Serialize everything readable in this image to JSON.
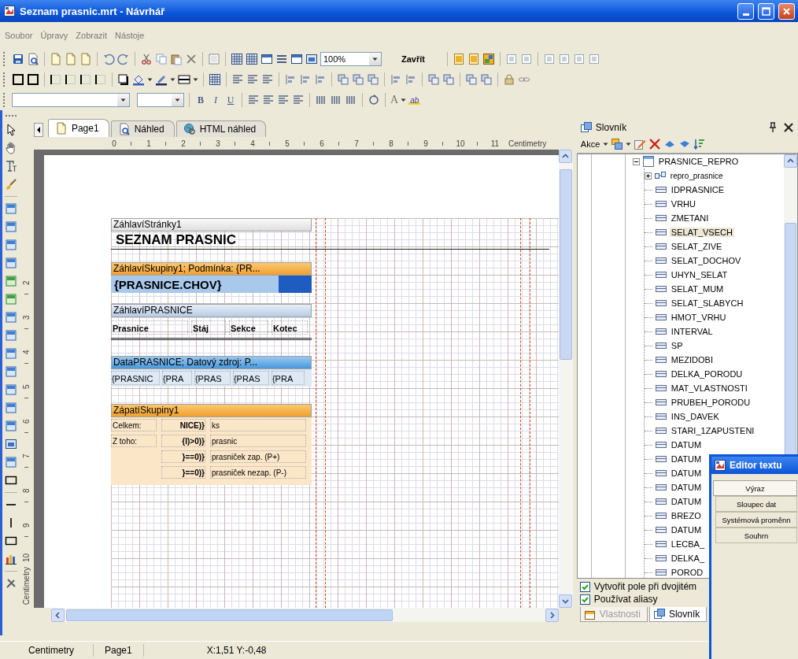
{
  "window": {
    "title": "Seznam prasnic.mrt - Návrhář"
  },
  "menu": [
    "Soubor",
    "Úpravy",
    "Zobrazit",
    "Nástoje"
  ],
  "toolbar": {
    "zoom": "100%",
    "close_button": "Zavřít"
  },
  "format_toolbar": {
    "styles": [
      "B",
      "I",
      "U"
    ],
    "font_color": "A",
    "highlight": "ab"
  },
  "tabs": [
    {
      "label": "Page1",
      "kind": "page",
      "selected": true
    },
    {
      "label": "Náhled",
      "kind": "preview",
      "selected": false
    },
    {
      "label": "HTML náhled",
      "kind": "html",
      "selected": false
    }
  ],
  "ruler": {
    "marks": [
      "0",
      "1",
      "2",
      "3",
      "4",
      "5",
      "6",
      "7",
      "8",
      "9",
      "10",
      "11"
    ],
    "unit": "Centimetry"
  },
  "vertical_ruler": {
    "marks": [
      "2",
      "3",
      "4",
      "5",
      "6",
      "7",
      "8",
      "9",
      "10"
    ],
    "unit": "Centimetry"
  },
  "bands": [
    {
      "kind": "page_header",
      "title": "ZáhlavíStránky1",
      "rows": [
        [
          "SEZNAM PRASNIC"
        ]
      ]
    },
    {
      "kind": "group_header",
      "title": "ZáhlavíSkupiny1; Podmínka: {PR...",
      "rows": [
        [
          "{PRASNICE.CHOV}"
        ]
      ]
    },
    {
      "kind": "header",
      "title": "ZáhlavíPRASNICE",
      "rows": [
        [
          "Prasnice",
          "Stáj",
          "Sekce",
          "Kotec"
        ]
      ]
    },
    {
      "kind": "data",
      "title": "DataPRASNICE; Datový zdroj: P...",
      "rows": [
        [
          "{PRASNIC",
          "{PRA",
          "{PRAS",
          "{PRAS",
          "{PRA"
        ]
      ]
    },
    {
      "kind": "group_footer",
      "title": "ZápatíSkupiny1",
      "rows": [
        {
          "label": "Celkem:",
          "value": "NICE)}",
          "unit": "ks"
        },
        {
          "label": "Z toho:",
          "value": "{I)>0)}",
          "unit": "prasnic"
        },
        {
          "value": "}==0)}",
          "unit": "prasniček zap. (P+)"
        },
        {
          "value": "}==0)}",
          "unit": "prasniček nezap. (P-)"
        }
      ]
    }
  ],
  "dictionary": {
    "title": "Slovník",
    "actions": "Akce",
    "tree": [
      {
        "label": "PRASNICE_REPRO",
        "kind": "table",
        "expanded": true,
        "selected": false,
        "children": [
          {
            "label": "repro_prasnice",
            "kind": "relation",
            "expanded": false,
            "selected": false
          },
          {
            "label": "IDPRASNICE",
            "kind": "column",
            "selected": false
          },
          {
            "label": "VRHU",
            "kind": "column",
            "selected": false
          },
          {
            "label": "ZMETANI",
            "kind": "column",
            "selected": false
          },
          {
            "label": "SELAT_VSECH",
            "kind": "column",
            "selected": true
          },
          {
            "label": "SELAT_ZIVE",
            "kind": "column",
            "selected": false
          },
          {
            "label": "SELAT_DOCHOV",
            "kind": "column",
            "selected": false
          },
          {
            "label": "UHYN_SELAT",
            "kind": "column",
            "selected": false
          },
          {
            "label": "SELAT_MUM",
            "kind": "column",
            "selected": false
          },
          {
            "label": "SELAT_SLABYCH",
            "kind": "column",
            "selected": false
          },
          {
            "label": "HMOT_VRHU",
            "kind": "column",
            "selected": false
          },
          {
            "label": "INTERVAL",
            "kind": "column",
            "selected": false
          },
          {
            "label": "SP",
            "kind": "column",
            "selected": false
          },
          {
            "label": "MEZIDOBI",
            "kind": "column",
            "selected": false
          },
          {
            "label": "DELKA_PORODU",
            "kind": "column",
            "selected": false
          },
          {
            "label": "MAT_VLASTNOSTI",
            "kind": "column",
            "selected": false
          },
          {
            "label": "PRUBEH_PORODU",
            "kind": "column",
            "selected": false
          },
          {
            "label": "INS_DAVEK",
            "kind": "column",
            "selected": false
          },
          {
            "label": "STARI_1ZAPUSTENI",
            "kind": "column",
            "selected": false
          },
          {
            "label": "DATUM",
            "kind": "column",
            "selected": false
          },
          {
            "label": "DATUM",
            "kind": "column",
            "selected": false
          },
          {
            "label": "DATUM",
            "kind": "column",
            "selected": false
          },
          {
            "label": "DATUM",
            "kind": "column",
            "selected": false
          },
          {
            "label": "DATUM",
            "kind": "column",
            "selected": false
          },
          {
            "label": "BREZO",
            "kind": "column",
            "selected": false
          },
          {
            "label": "DATUM",
            "kind": "column",
            "selected": false
          },
          {
            "label": "LECBA_",
            "kind": "column",
            "selected": false
          },
          {
            "label": "DELKA_",
            "kind": "column",
            "selected": false
          },
          {
            "label": "POROD",
            "kind": "column",
            "selected": false
          }
        ]
      }
    ],
    "options": [
      {
        "label": "Vytvořit pole při dvojitém",
        "checked": true
      },
      {
        "label": "Používat aliasy",
        "checked": true
      }
    ],
    "tabs": [
      {
        "label": "Vlastnosti",
        "kind": "properties",
        "selected": false
      },
      {
        "label": "Slovník",
        "kind": "dictionary",
        "selected": true
      }
    ]
  },
  "text_editor": {
    "title": "Editor textu",
    "buttons": [
      {
        "label": "Výraz",
        "selected": true
      },
      {
        "label": "Sloupec dat",
        "selected": false
      },
      {
        "label": "Systémová proměnn",
        "selected": false
      },
      {
        "label": "Souhrn",
        "selected": false
      }
    ]
  },
  "status_bar": [
    "Centimetry",
    "Page1",
    "X:1,51 Y:-0,48"
  ]
}
